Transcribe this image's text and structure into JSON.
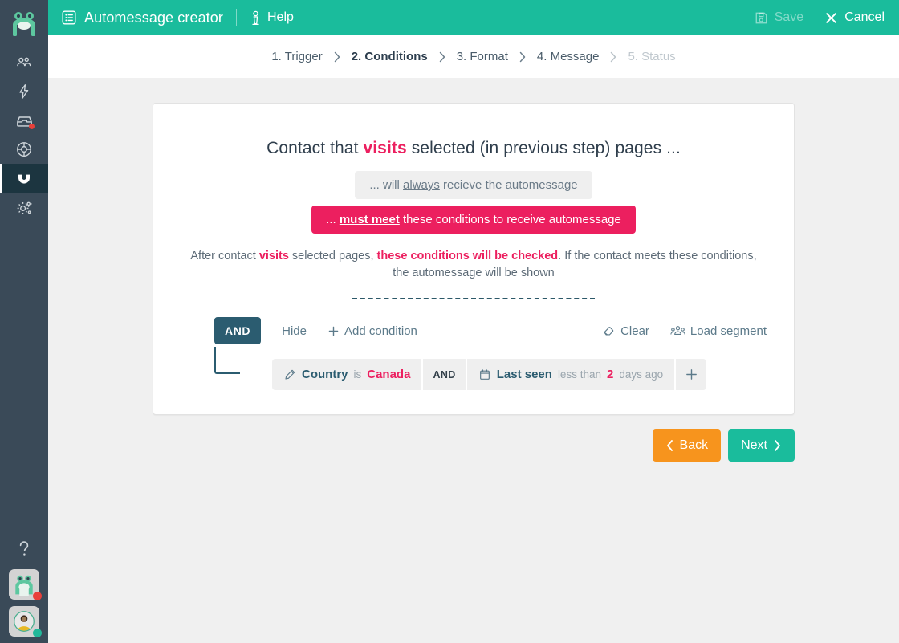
{
  "sidebar": {
    "logo_icon": "frog-logo-icon",
    "items": [
      {
        "icon": "contacts-people-icon",
        "name": "contacts",
        "active": false,
        "badge": false
      },
      {
        "icon": "lightning-bolt-icon",
        "name": "automation",
        "active": false,
        "badge": false
      },
      {
        "icon": "inbox-tray-icon",
        "name": "inbox",
        "active": false,
        "badge": true
      },
      {
        "icon": "lifebuoy-support-icon",
        "name": "support",
        "active": false,
        "badge": false
      },
      {
        "icon": "magnet-icon",
        "name": "lead-magnet",
        "active": true,
        "badge": false
      },
      {
        "icon": "gears-settings-icon",
        "name": "settings",
        "active": false,
        "badge": false
      }
    ],
    "bottom": {
      "help_icon": "question-mark-icon",
      "mascot_avatar_icon": "frog-avatar-icon",
      "mascot_badge_color": "#e8403a",
      "user_avatar_icon": "user-avatar-icon",
      "user_badge_color": "#22b89a"
    }
  },
  "topbar": {
    "app_icon": "list-document-icon",
    "title": "Automessage creator",
    "help_icon": "help-info-icon",
    "help_label": "Help",
    "save_icon": "floppy-save-icon",
    "save_label": "Save",
    "save_disabled": true,
    "cancel_icon": "close-x-icon",
    "cancel_label": "Cancel",
    "background": "#1abc9c"
  },
  "steps": [
    {
      "label": "1. Trigger",
      "state": "done"
    },
    {
      "label": "2. Conditions",
      "state": "current"
    },
    {
      "label": "3. Format",
      "state": "done"
    },
    {
      "label": "4. Message",
      "state": "done"
    },
    {
      "label": "5. Status",
      "state": "disabled"
    }
  ],
  "card": {
    "headline": {
      "part1": "Contact that ",
      "highlight": "visits",
      "part2": " selected (in previous step) pages ..."
    },
    "options": [
      {
        "id": "always",
        "prefix": "... will ",
        "underlined": "always",
        "suffix": " recieve the automessage",
        "selected": false
      },
      {
        "id": "must-meet",
        "prefix": "... ",
        "underlined": "must meet",
        "suffix": " these conditions to receive automessage",
        "selected": true
      }
    ],
    "explanation": {
      "p1": "After contact ",
      "h1": "visits",
      "p2": " selected pages, ",
      "h2": "these conditions will be checked",
      "p3": ". If the contact meets these conditions, the automessage will be shown"
    },
    "builder": {
      "logic_operator": "AND",
      "hide_label": "Hide",
      "add_condition_icon": "plus-icon",
      "add_condition_label": "Add condition",
      "clear_icon": "eraser-icon",
      "clear_label": "Clear",
      "load_segment_icon": "group-people-icon",
      "load_segment_label": "Load segment",
      "conditions": [
        {
          "icon": "pencil-icon",
          "field": "Country",
          "operator": "is",
          "value": "Canada",
          "suffix": ""
        },
        {
          "icon": "calendar-icon",
          "field": "Last seen",
          "operator": "less than",
          "value": "2",
          "suffix": "days ago"
        }
      ],
      "join_label": "AND",
      "add_chip_icon": "plus-icon"
    }
  },
  "footer": {
    "back_icon": "chevron-left-icon",
    "back_label": "Back",
    "back_color": "#f7941d",
    "next_label": "Next",
    "next_icon": "chevron-right-icon",
    "next_color": "#1abc9c"
  },
  "colors": {
    "accent_pink": "#ec1f5f",
    "accent_green": "#1abc9c",
    "accent_teal": "#2b5c70",
    "sidebar": "#3a4a58"
  }
}
